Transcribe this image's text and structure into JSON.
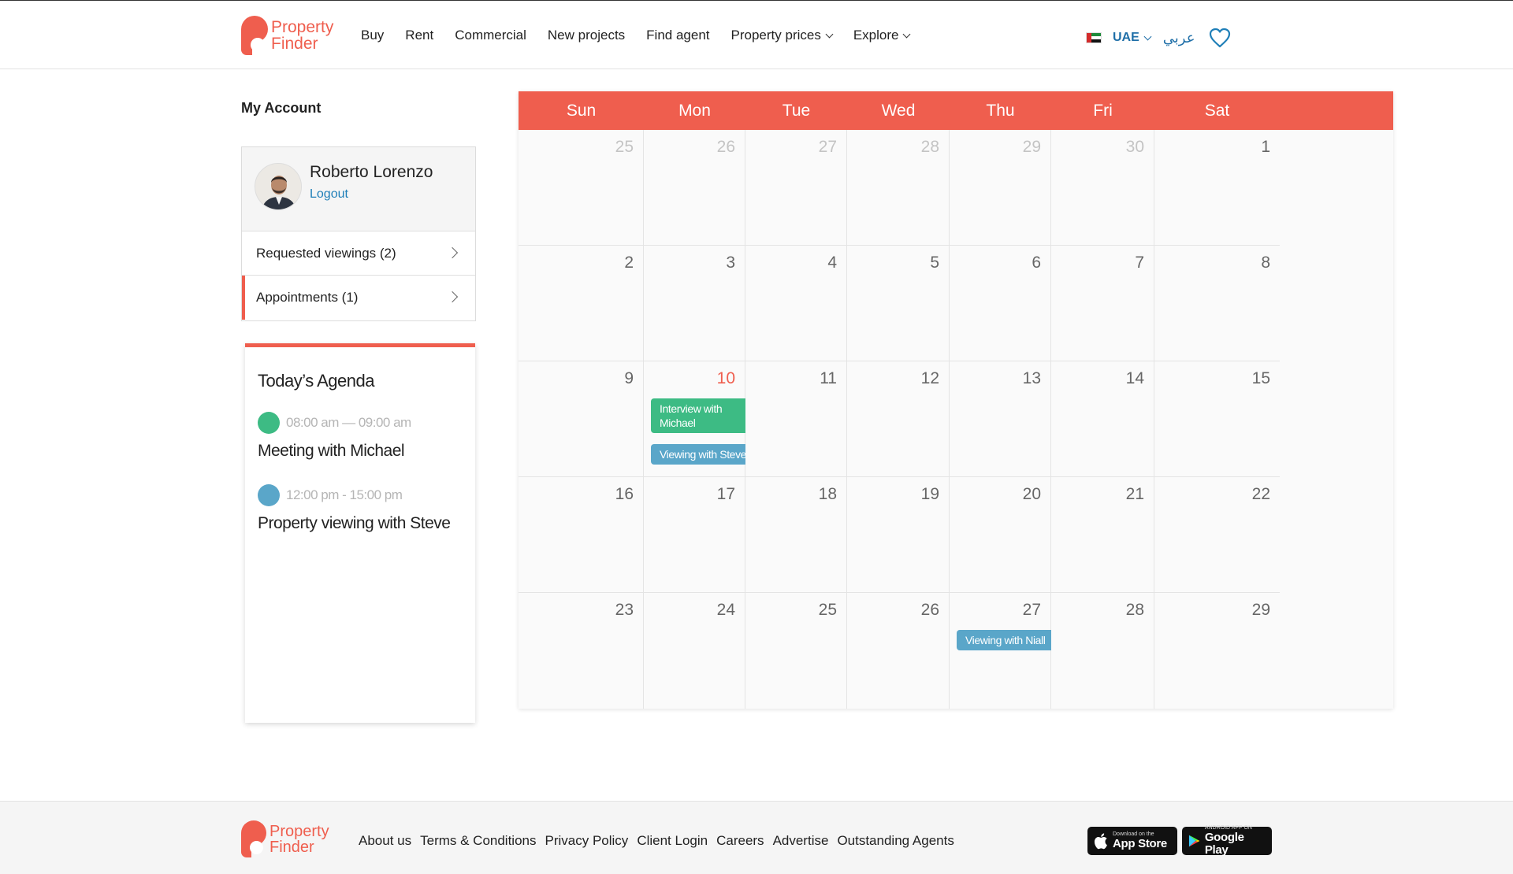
{
  "header": {
    "logo_text_line1": "Property",
    "logo_text_line2": "Finder",
    "nav": [
      "Buy",
      "Rent",
      "Commercial",
      "New projects",
      "Find agent",
      "Property prices",
      "Explore"
    ],
    "nav_dropdowns": [
      "Property prices",
      "Explore"
    ],
    "country": "UAE",
    "language": "عربي",
    "favorites_icon": "heart-icon"
  },
  "sidebar": {
    "title": "My Account",
    "user_name": "Roberto Lorenzo",
    "logout_label": "Logout",
    "menu": [
      {
        "label": "Requested viewings (2)",
        "active": false
      },
      {
        "label": "Appointments (1)",
        "active": true
      }
    ]
  },
  "agenda": {
    "title": "Today’s Agenda",
    "items": [
      {
        "time": "08:00 am — 09:00 am",
        "title": "Meeting with Michael",
        "color": "#3dbb84"
      },
      {
        "time": "12:00 pm - 15:00 pm",
        "title": "Property viewing with Steve",
        "color": "#5aa6c9"
      }
    ]
  },
  "calendar": {
    "weekdays": [
      "Sun",
      "Mon",
      "Tue",
      "Wed",
      "Thu",
      "Fri",
      "Sat"
    ],
    "today": "10",
    "weeks": [
      [
        {
          "d": "25",
          "m": true
        },
        {
          "d": "26",
          "m": true
        },
        {
          "d": "27",
          "m": true
        },
        {
          "d": "28",
          "m": true
        },
        {
          "d": "29",
          "m": true
        },
        {
          "d": "30",
          "m": true
        },
        {
          "d": "1"
        }
      ],
      [
        {
          "d": "2"
        },
        {
          "d": "3"
        },
        {
          "d": "4"
        },
        {
          "d": "5"
        },
        {
          "d": "6"
        },
        {
          "d": "7"
        },
        {
          "d": "8"
        }
      ],
      [
        {
          "d": "9"
        },
        {
          "d": "10"
        },
        {
          "d": "11"
        },
        {
          "d": "12"
        },
        {
          "d": "13"
        },
        {
          "d": "14"
        },
        {
          "d": "15"
        }
      ],
      [
        {
          "d": "16"
        },
        {
          "d": "17"
        },
        {
          "d": "18"
        },
        {
          "d": "19"
        },
        {
          "d": "20"
        },
        {
          "d": "21"
        },
        {
          "d": "22"
        }
      ],
      [
        {
          "d": "23"
        },
        {
          "d": "24"
        },
        {
          "d": "25"
        },
        {
          "d": "26"
        },
        {
          "d": "27"
        },
        {
          "d": "28"
        },
        {
          "d": "29"
        }
      ]
    ],
    "events": [
      {
        "week": 2,
        "day": 1,
        "label": "Interview with Michael",
        "color": "green",
        "lines": 2
      },
      {
        "week": 2,
        "day": 1,
        "label": "Viewing with Steve",
        "color": "blue",
        "lines": 1
      },
      {
        "week": 4,
        "day": 4,
        "label": "Viewing with Niall",
        "color": "blue",
        "lines": 2
      }
    ]
  },
  "footer": {
    "links": [
      "About us",
      "Terms & Conditions",
      "Privacy Policy",
      "Client Login",
      "Careers",
      "Advertise",
      "Outstanding Agents"
    ],
    "app_store_small": "Download on the",
    "app_store_big": "App Store",
    "google_play_small": "ANDROID APP ON",
    "google_play_big": "Google Play"
  },
  "colors": {
    "brand": "#ef5e4e",
    "link": "#1f7fb8",
    "event_green": "#3dbb84",
    "event_blue": "#5aa6c9"
  }
}
